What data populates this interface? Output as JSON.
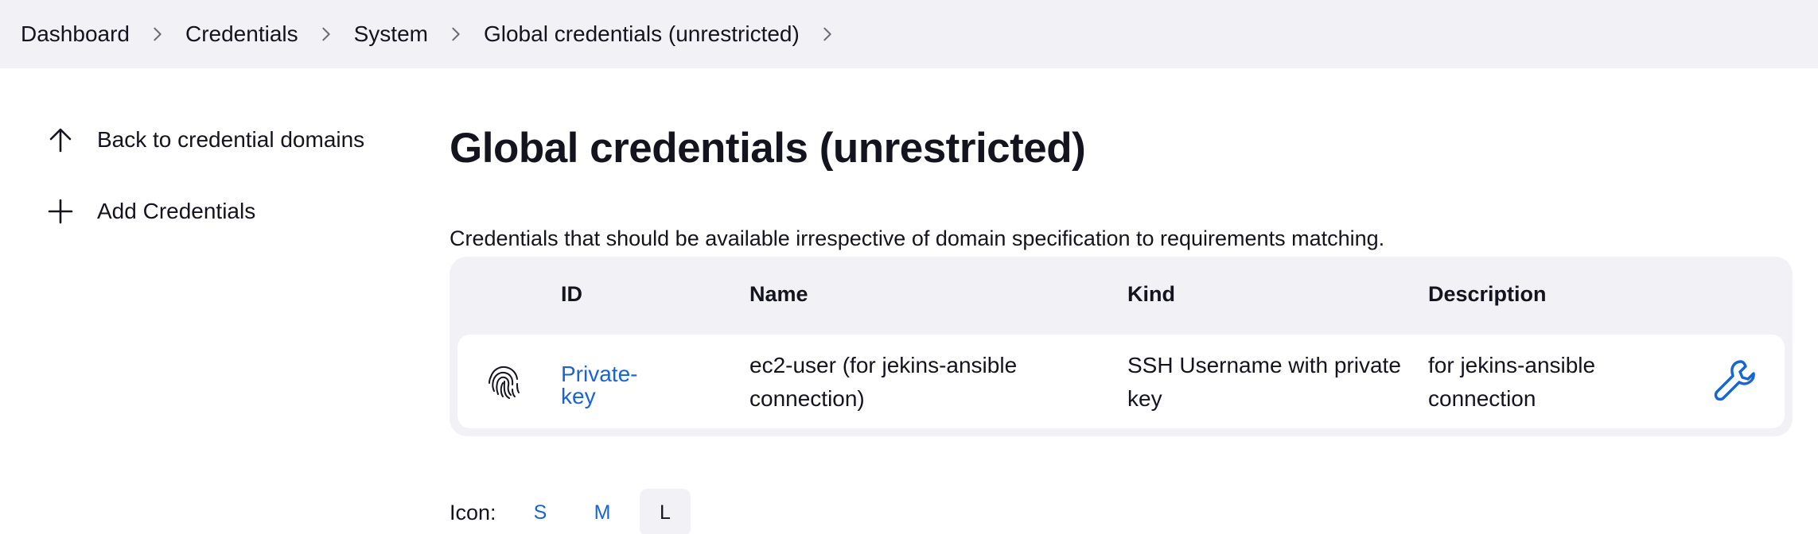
{
  "breadcrumb": {
    "items": [
      "Dashboard",
      "Credentials",
      "System",
      "Global credentials (unrestricted)"
    ]
  },
  "sidebar": {
    "items": [
      {
        "label": "Back to credential domains",
        "icon": "arrow-up-icon"
      },
      {
        "label": "Add Credentials",
        "icon": "plus-icon"
      }
    ]
  },
  "main": {
    "title": "Global credentials (unrestricted)",
    "description": "Credentials that should be available irrespective of domain specification to requirements matching.",
    "table": {
      "headers": {
        "id": "ID",
        "name": "Name",
        "kind": "Kind",
        "description": "Description"
      },
      "rows": [
        {
          "icon": "fingerprint-icon",
          "id": "Private-key",
          "id_line1": "Private-",
          "id_line2": "key",
          "name_line1": "ec2-user (for jekins-ansible",
          "name_line2": "connection)",
          "kind_line1": "SSH Username with private",
          "kind_line2": "key",
          "description_line1": "for jekins-ansible",
          "description_line2": "connection",
          "action_icon": "wrench-icon"
        }
      ]
    }
  },
  "icon_size": {
    "label": "Icon:",
    "options": [
      "S",
      "M",
      "L"
    ],
    "selected": "L"
  },
  "colors": {
    "link": "#1764d6",
    "panel": "#f2f1f6",
    "text": "#14141f"
  }
}
